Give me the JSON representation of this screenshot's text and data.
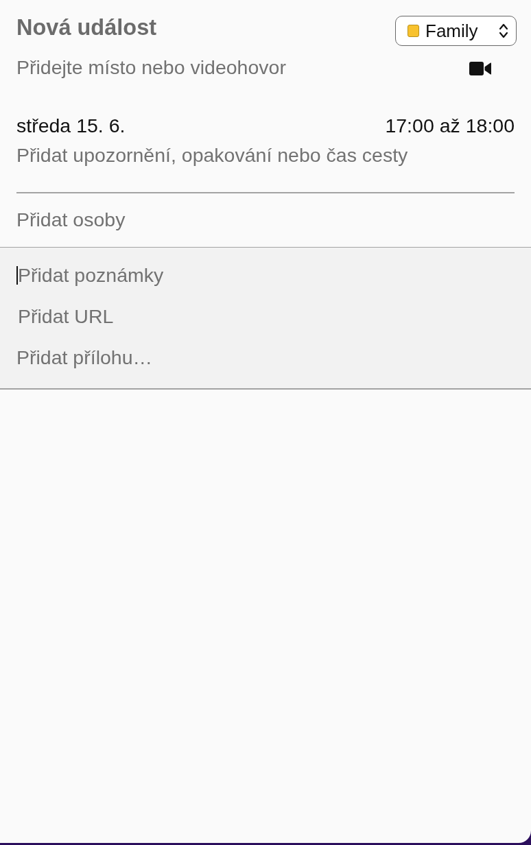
{
  "event": {
    "title": "Nová událost",
    "calendar": {
      "name": "Family",
      "color": "#f8c22e"
    }
  },
  "location": {
    "placeholder": "Přidejte místo nebo videohovor"
  },
  "schedule": {
    "date": "středa 15. 6.",
    "time": "17:00 až 18:00",
    "details": "Přidat upozornění, opakování nebo čas cesty"
  },
  "invitees": {
    "placeholder": "Přidat osoby"
  },
  "extras": [
    {
      "kind": "field",
      "placeholder": "Přidat poznámky",
      "focused": true
    },
    {
      "kind": "field",
      "placeholder": "Přidat URL",
      "focused": false
    },
    {
      "kind": "action",
      "label": "Přidat přílohu…"
    }
  ]
}
